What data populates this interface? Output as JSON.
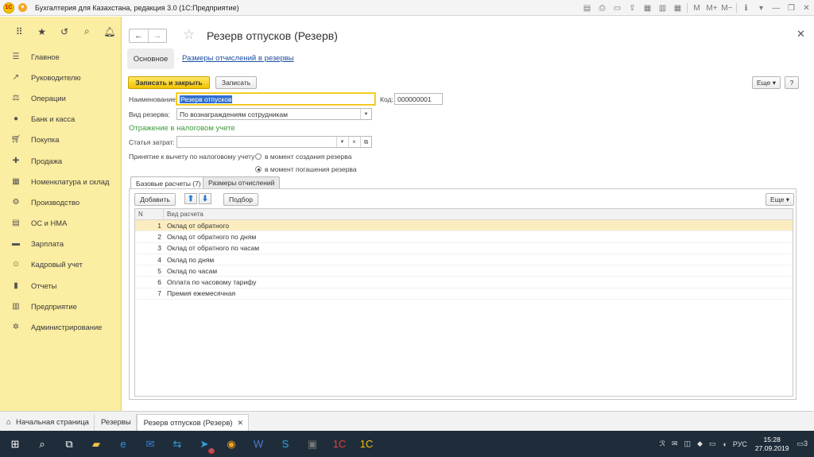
{
  "window": {
    "logo": "1С",
    "title": "Бухгалтерия для Казахстана, редакция 3.0  (1С:Предприятие)"
  },
  "sidebar": {
    "items": [
      {
        "label": "Главное",
        "icon": "menu-lines-icon"
      },
      {
        "label": "Руководителю",
        "icon": "trend-chart-icon"
      },
      {
        "label": "Операции",
        "icon": "operations-icon"
      },
      {
        "label": "Банк и касса",
        "icon": "coin-icon"
      },
      {
        "label": "Покупка",
        "icon": "cart-icon"
      },
      {
        "label": "Продажа",
        "icon": "sale-icon"
      },
      {
        "label": "Номенклатура и склад",
        "icon": "warehouse-icon"
      },
      {
        "label": "Производство",
        "icon": "factory-icon"
      },
      {
        "label": "ОС и НМА",
        "icon": "assets-icon"
      },
      {
        "label": "Зарплата",
        "icon": "salary-icon"
      },
      {
        "label": "Кадровый учет",
        "icon": "personnel-icon"
      },
      {
        "label": "Отчеты",
        "icon": "reports-icon"
      },
      {
        "label": "Предприятие",
        "icon": "enterprise-icon"
      },
      {
        "label": "Администрирование",
        "icon": "admin-gear-icon"
      }
    ]
  },
  "document": {
    "title": "Резерв отпусков (Резерв)",
    "nav_main": "Основное",
    "nav_link": "Размеры отчислений в резервы",
    "btn_save_close": "Записать и закрыть",
    "btn_save": "Записать",
    "btn_more": "Еще",
    "btn_help": "?",
    "name_label": "Наименование:",
    "name_value": "Резерв отпусков",
    "code_label": "Код:",
    "code_value": "000000001",
    "type_label": "Вид резерва:",
    "type_value": "По вознаграждениям сотрудникам",
    "tax_header": "Отражение в налоговом учете",
    "cost_label": "Статья затрат:",
    "cost_value": "",
    "deduction_label": "Принятие к вычету по налоговому учету",
    "radio1": "в момент создания резерва",
    "radio2": "в момент погашения резерва",
    "radio_selected": 2
  },
  "tabs": {
    "tab1": "Базовые расчеты (7)",
    "tab2": "Размеры отчислений",
    "btn_add": "Добавить",
    "btn_select": "Подбор",
    "btn_more": "Еще"
  },
  "table": {
    "col_n": "N",
    "col_type": "Вид расчета",
    "rows": [
      {
        "n": "1",
        "name": "Оклад от обратного"
      },
      {
        "n": "2",
        "name": "Оклад от обратного по дням"
      },
      {
        "n": "3",
        "name": "Оклад от обратного по часам"
      },
      {
        "n": "4",
        "name": "Оклад по дням"
      },
      {
        "n": "5",
        "name": "Оклад по часам"
      },
      {
        "n": "6",
        "name": "Оплата по часовому тарифу"
      },
      {
        "n": "7",
        "name": "Премия ежемесячная"
      }
    ]
  },
  "open_windows": {
    "home": "Начальная страница",
    "reserves": "Резервы",
    "current": "Резерв отпусков (Резерв)"
  },
  "taskbar": {
    "lang": "РУС",
    "time": "15:28",
    "date": "27.09.2019",
    "notifications": "3",
    "telegram_badge": "4"
  },
  "colors": {
    "sidebar_bg": "#fbeda1",
    "primary_button": "#f2c100",
    "link": "#1c4fa0",
    "section_header": "#3a9a3a",
    "selected_row": "#fbedbf"
  }
}
